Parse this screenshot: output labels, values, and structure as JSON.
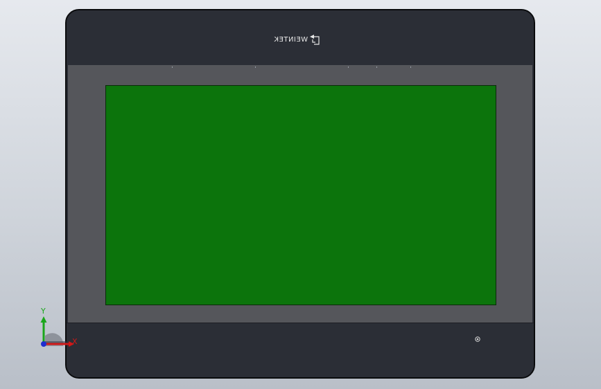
{
  "device": {
    "brand_text": "WEINTEK",
    "logo_icon": "weintek-logo-icon",
    "status_icon": "power-led-icon",
    "screen_color": "#0c740c",
    "bezel_color": "#2a2d35",
    "frame_color": "#55565b"
  },
  "triad": {
    "x_label": "X",
    "y_label": "Y",
    "x_color": "#d01818",
    "y_color": "#1aa61a",
    "z_color": "#1f2ed0"
  }
}
